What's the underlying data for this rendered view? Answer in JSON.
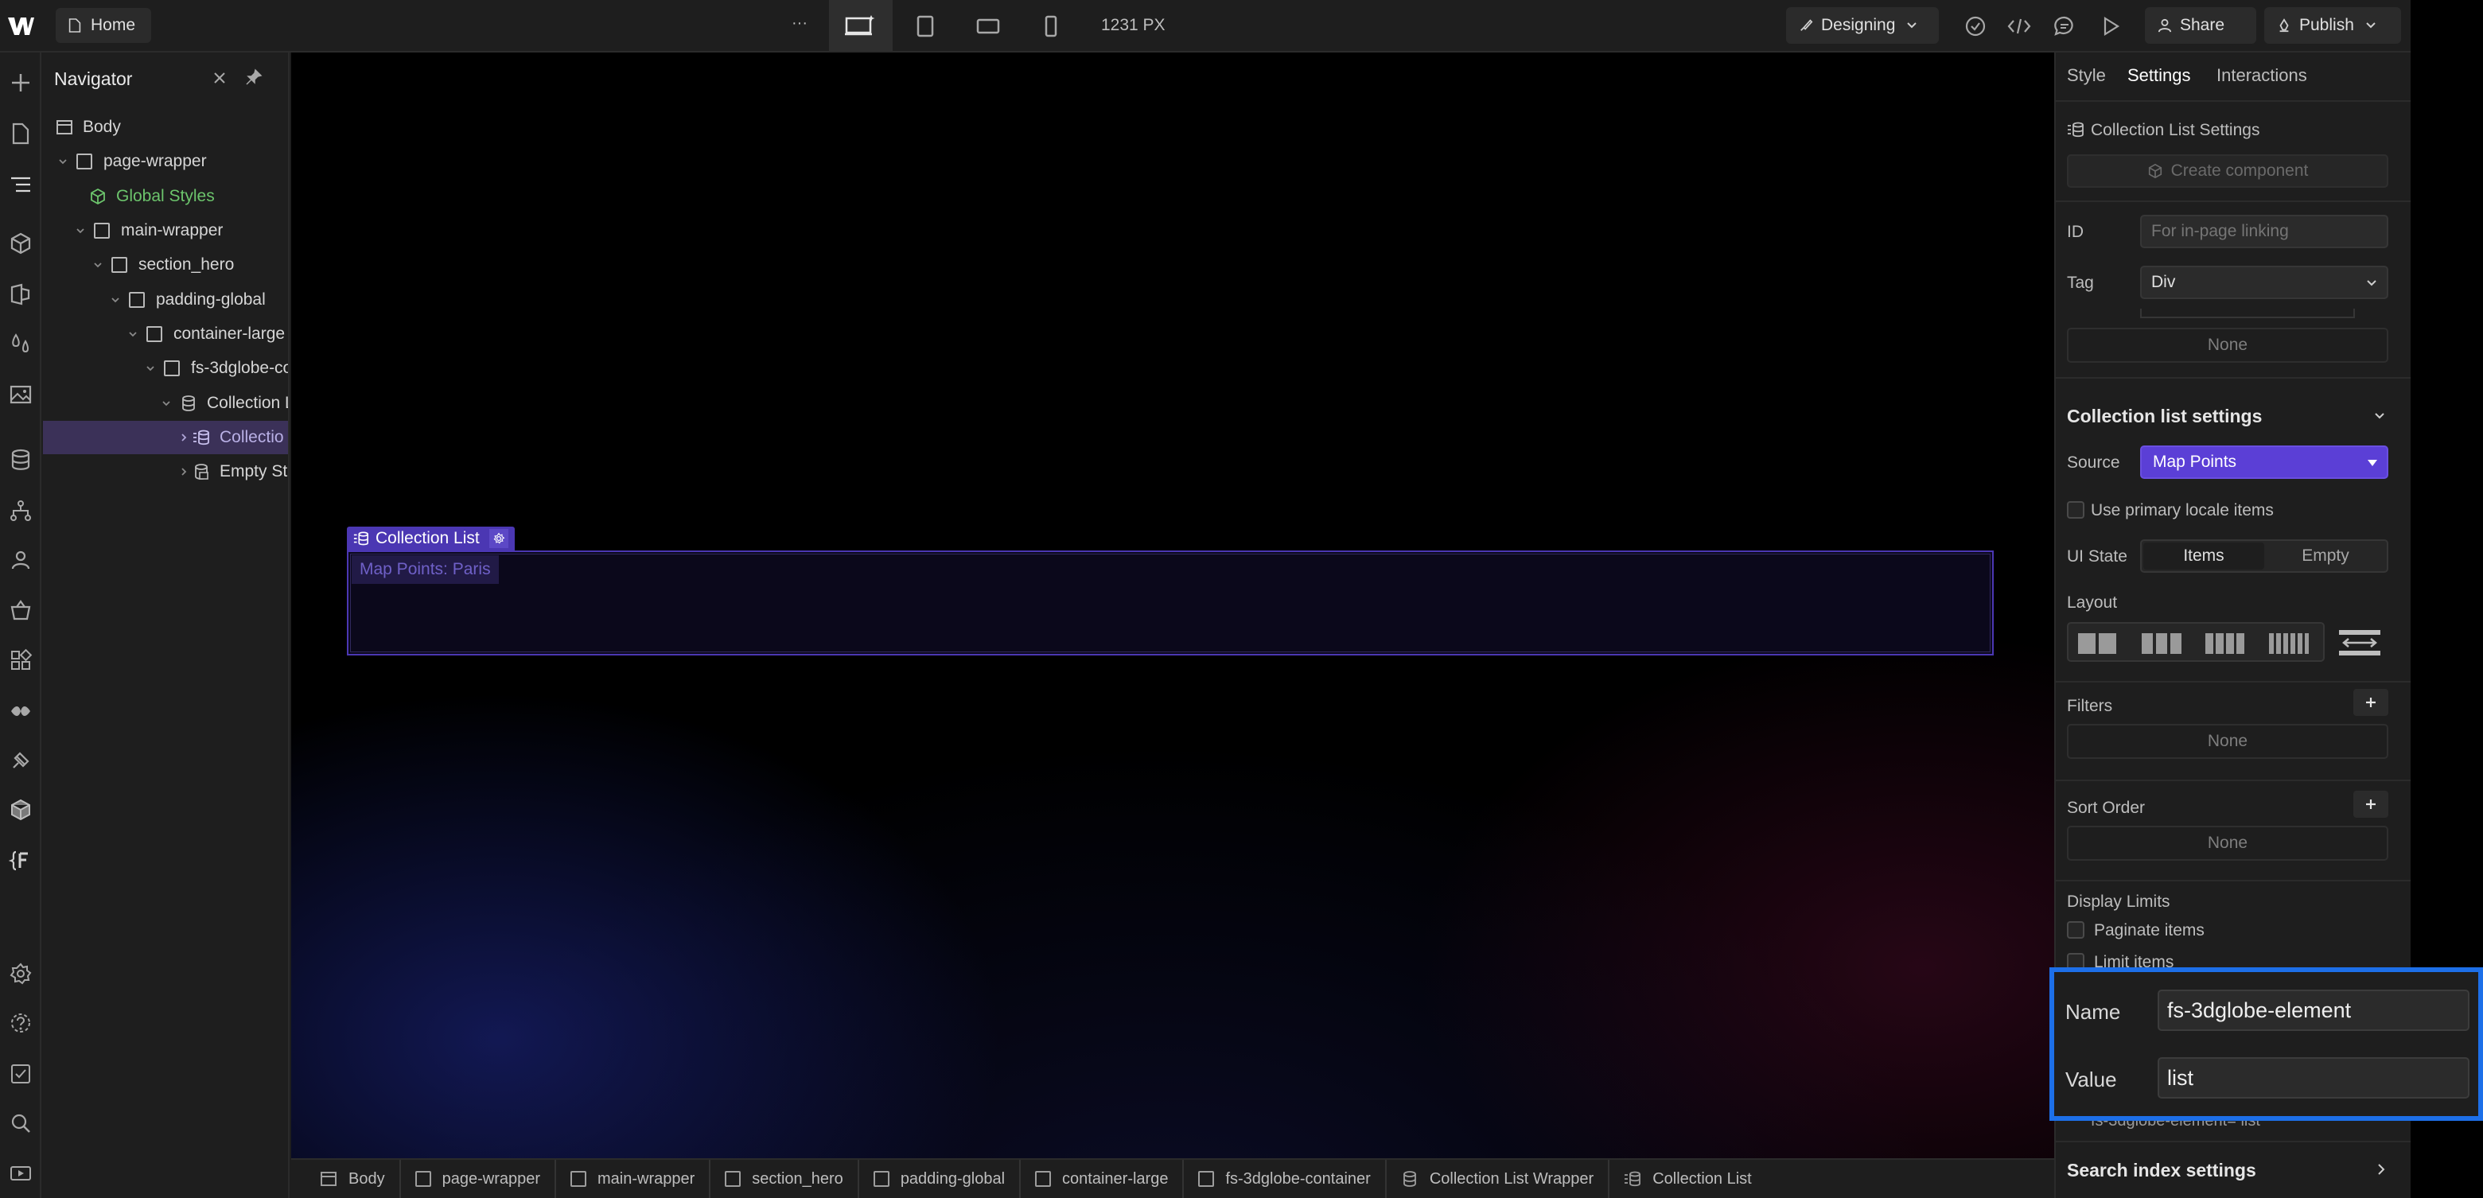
{
  "topbar": {
    "home_label": "Home",
    "more_label": "···",
    "width_readout": "1231 PX",
    "mode_label": "Designing",
    "share_label": "Share",
    "publish_label": "Publish"
  },
  "navigator": {
    "title": "Navigator",
    "items": [
      {
        "label": "Body"
      },
      {
        "label": "page-wrapper"
      },
      {
        "label": "Global Styles"
      },
      {
        "label": "main-wrapper"
      },
      {
        "label": "section_hero"
      },
      {
        "label": "padding-global"
      },
      {
        "label": "container-large"
      },
      {
        "label": "fs-3dglobe-co"
      },
      {
        "label": "Collection L"
      },
      {
        "label": "Collectio"
      },
      {
        "label": "Empty St"
      }
    ]
  },
  "canvas": {
    "element_tag_label": "Collection List",
    "item_label": "Map Points: Paris"
  },
  "breadcrumb": [
    {
      "label": "Body"
    },
    {
      "label": "page-wrapper"
    },
    {
      "label": "main-wrapper"
    },
    {
      "label": "section_hero"
    },
    {
      "label": "padding-global"
    },
    {
      "label": "container-large"
    },
    {
      "label": "fs-3dglobe-container"
    },
    {
      "label": "Collection List Wrapper"
    },
    {
      "label": "Collection List"
    }
  ],
  "panel": {
    "tabs": [
      "Style",
      "Settings",
      "Interactions"
    ],
    "active_tab": "Settings",
    "section_title": "Collection List Settings",
    "create_component_label": "Create component",
    "id_label": "ID",
    "id_placeholder": "For in-page linking",
    "tag_label": "Tag",
    "tag_value": "Div",
    "none_label": "None",
    "cl_settings_title": "Collection list settings",
    "source_label": "Source",
    "source_value": "Map Points",
    "primary_locale_label": "Use primary locale items",
    "ui_state_label": "UI State",
    "ui_state_items": "Items",
    "ui_state_empty": "Empty",
    "layout_label": "Layout",
    "filters_label": "Filters",
    "filters_value": "None",
    "sort_label": "Sort Order",
    "sort_value": "None",
    "display_limits_label": "Display Limits",
    "paginate_label": "Paginate items",
    "limit_label": "Limit items",
    "attr_summary": "fs-3dglobe-element= list",
    "search_index_label": "Search index settings"
  },
  "overlay": {
    "name_label": "Name",
    "name_value": "fs-3dglobe-element",
    "value_label": "Value",
    "value_value": "list"
  },
  "colors": {
    "accent_purple": "#5b3fd6",
    "highlight_blue": "#1d6fe8",
    "green_text": "#6cc46c"
  }
}
